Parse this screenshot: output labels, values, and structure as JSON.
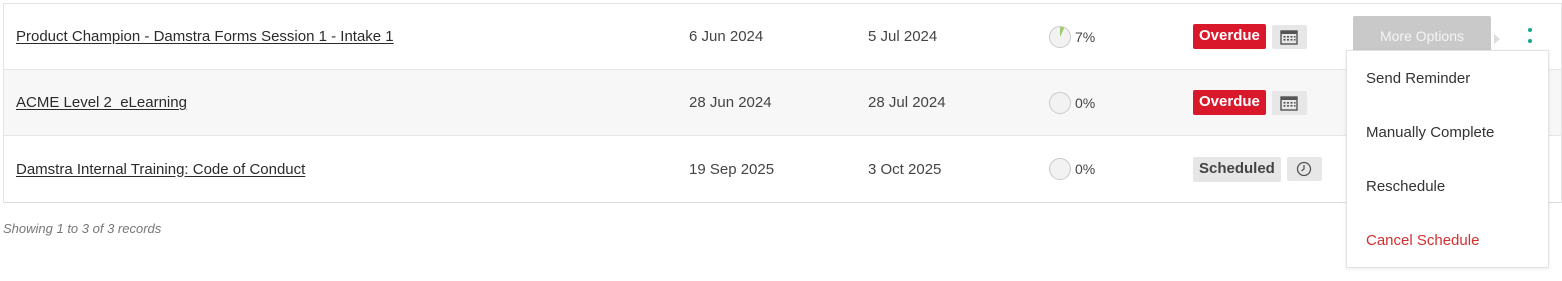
{
  "rows": [
    {
      "title": "Product Champion - Damstra Forms Session 1 - Intake 1",
      "start": "6 Jun 2024",
      "due": "5 Jul 2024",
      "progress": "7%",
      "progress_value": 7,
      "status": "Overdue",
      "status_icon": "calendar-icon"
    },
    {
      "title": "ACME Level 2_eLearning",
      "start": "28 Jun 2024",
      "due": "28 Jul 2024",
      "progress": "0%",
      "progress_value": 0,
      "status": "Overdue",
      "status_icon": "calendar-icon"
    },
    {
      "title": "Damstra Internal Training: Code of Conduct",
      "start": "19 Sep 2025",
      "due": "3 Oct 2025",
      "progress": "0%",
      "progress_value": 0,
      "status": "Scheduled",
      "status_icon": "clock-icon"
    }
  ],
  "actions": {
    "more_options_label": "More Options",
    "menu": [
      {
        "label": "Send Reminder"
      },
      {
        "label": "Manually Complete"
      },
      {
        "label": "Reschedule"
      },
      {
        "label": "Cancel Schedule"
      }
    ]
  },
  "footer": {
    "records_text": "Showing 1 to 3 of 3 records"
  },
  "colors": {
    "overdue": "#d9182c",
    "scheduled_bg": "#e6e6e6",
    "accent": "#1aa58d",
    "danger_text": "#d22f2f",
    "progress_fill": "#9acc6a"
  }
}
